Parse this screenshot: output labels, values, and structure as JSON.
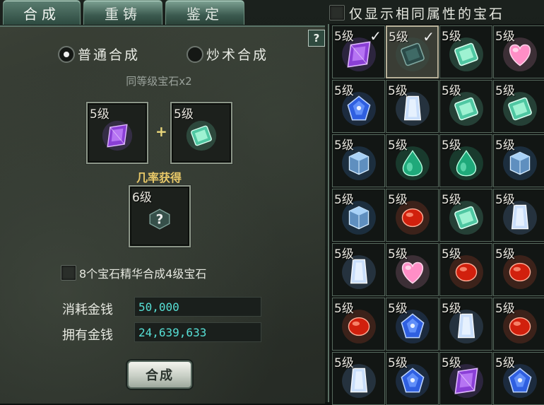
{
  "tabs": [
    {
      "label": "合成",
      "active": true
    },
    {
      "label": "重铸",
      "active": false
    },
    {
      "label": "鉴定",
      "active": false
    }
  ],
  "filter": {
    "label": "仅显示相同属性的宝石",
    "checked": false
  },
  "help": {
    "label": "?"
  },
  "modes": [
    {
      "label": "普通合成",
      "selected": true
    },
    {
      "label": "炒术合成",
      "selected": false
    }
  ],
  "subtitle": "同等级宝石x2",
  "inputs": [
    {
      "level": "5级",
      "gem": "purple-crystal"
    },
    {
      "level": "5级",
      "gem": "green-emerald"
    }
  ],
  "plus": "+",
  "result": {
    "label": "几率获得",
    "level": "6级",
    "gem": "unknown-gem-question-icon"
  },
  "essence": {
    "label": "8个宝石精华合成4级宝石",
    "checked": false
  },
  "money": {
    "cost_label": "消耗金钱",
    "cost_value": "50,000",
    "own_label": "拥有金钱",
    "own_value": "24,639,633"
  },
  "combine_button": "合成",
  "colors": {
    "money_text": "#57e0d6",
    "result_label": "#e8c868",
    "tab_green": "#3c5b50"
  },
  "inventory": [
    {
      "level": "5级",
      "gem": "purple-crystal",
      "checked": true,
      "selected": false
    },
    {
      "level": "5级",
      "gem": "dark-teal-emerald",
      "checked": true,
      "selected": true
    },
    {
      "level": "5级",
      "gem": "green-emerald",
      "checked": false,
      "selected": false
    },
    {
      "level": "5级",
      "gem": "pink-heart",
      "checked": false,
      "selected": false
    },
    {
      "level": "5级",
      "gem": "blue-sapphire",
      "checked": false,
      "selected": false
    },
    {
      "level": "5级",
      "gem": "white-crystal",
      "checked": false,
      "selected": false
    },
    {
      "level": "5级",
      "gem": "green-emerald",
      "checked": false,
      "selected": false
    },
    {
      "level": "5级",
      "gem": "green-emerald",
      "checked": false,
      "selected": false
    },
    {
      "level": "5级",
      "gem": "blue-cube",
      "checked": false,
      "selected": false
    },
    {
      "level": "5级",
      "gem": "green-teardrop",
      "checked": false,
      "selected": false
    },
    {
      "level": "5级",
      "gem": "green-teardrop",
      "checked": false,
      "selected": false
    },
    {
      "level": "5级",
      "gem": "blue-cube",
      "checked": false,
      "selected": false
    },
    {
      "level": "5级",
      "gem": "blue-cube",
      "checked": false,
      "selected": false
    },
    {
      "level": "5级",
      "gem": "red-ruby",
      "checked": false,
      "selected": false
    },
    {
      "level": "5级",
      "gem": "green-emerald",
      "checked": false,
      "selected": false
    },
    {
      "level": "5级",
      "gem": "white-crystal",
      "checked": false,
      "selected": false
    },
    {
      "level": "5级",
      "gem": "white-crystal",
      "checked": false,
      "selected": false
    },
    {
      "level": "5级",
      "gem": "pink-heart",
      "checked": false,
      "selected": false
    },
    {
      "level": "5级",
      "gem": "red-ruby",
      "checked": false,
      "selected": false
    },
    {
      "level": "5级",
      "gem": "red-ruby",
      "checked": false,
      "selected": false
    },
    {
      "level": "5级",
      "gem": "red-ruby",
      "checked": false,
      "selected": false
    },
    {
      "level": "5级",
      "gem": "blue-sapphire",
      "checked": false,
      "selected": false
    },
    {
      "level": "5级",
      "gem": "white-crystal",
      "checked": false,
      "selected": false
    },
    {
      "level": "5级",
      "gem": "red-ruby",
      "checked": false,
      "selected": false
    },
    {
      "level": "5级",
      "gem": "white-crystal",
      "checked": false,
      "selected": false
    },
    {
      "level": "5级",
      "gem": "blue-sapphire",
      "checked": false,
      "selected": false
    },
    {
      "level": "5级",
      "gem": "purple-crystal",
      "checked": false,
      "selected": false
    },
    {
      "level": "5级",
      "gem": "blue-sapphire",
      "checked": false,
      "selected": false
    }
  ]
}
